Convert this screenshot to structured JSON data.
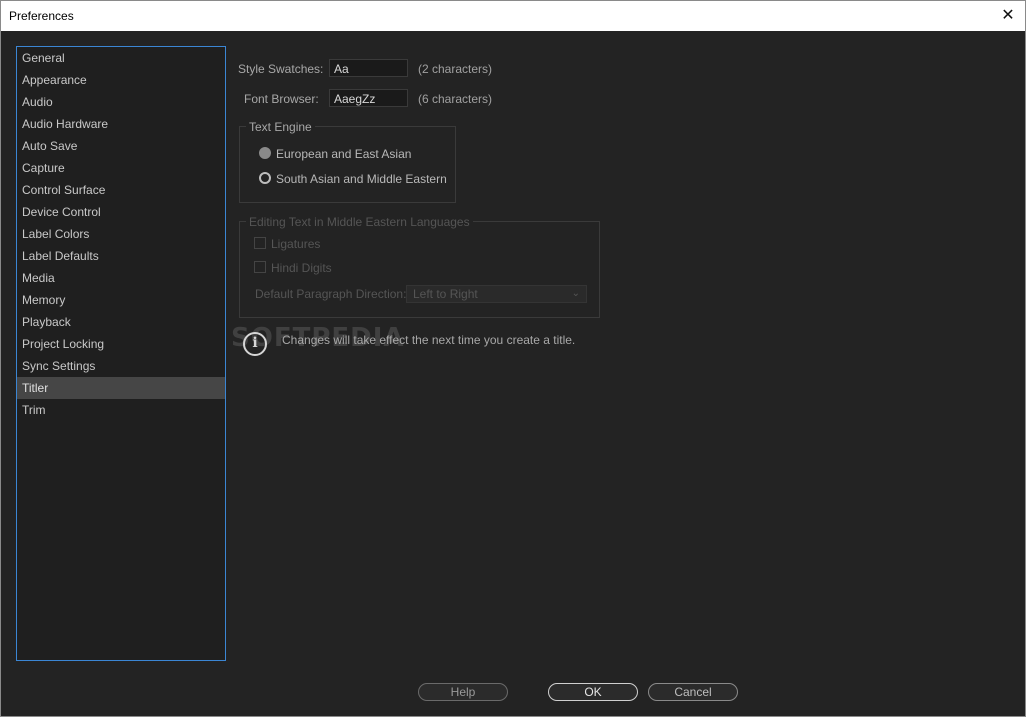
{
  "window": {
    "title": "Preferences",
    "close_symbol": "✕"
  },
  "sidebar": {
    "items": [
      {
        "label": "General"
      },
      {
        "label": "Appearance"
      },
      {
        "label": "Audio"
      },
      {
        "label": "Audio Hardware"
      },
      {
        "label": "Auto Save"
      },
      {
        "label": "Capture"
      },
      {
        "label": "Control Surface"
      },
      {
        "label": "Device Control"
      },
      {
        "label": "Label Colors"
      },
      {
        "label": "Label Defaults"
      },
      {
        "label": "Media"
      },
      {
        "label": "Memory"
      },
      {
        "label": "Playback"
      },
      {
        "label": "Project Locking"
      },
      {
        "label": "Sync Settings"
      },
      {
        "label": "Titler",
        "selected": true
      },
      {
        "label": "Trim"
      }
    ]
  },
  "titler": {
    "style_swatches": {
      "label": "Style Swatches:",
      "value": "Aa",
      "hint": "(2 characters)"
    },
    "font_browser": {
      "label": "Font Browser:",
      "value": "AaegZz",
      "hint": "(6 characters)"
    },
    "text_engine": {
      "title": "Text Engine",
      "options": [
        {
          "label": "European and East Asian",
          "checked": true
        },
        {
          "label": "South Asian and Middle Eastern",
          "checked": false
        }
      ]
    },
    "middle_eastern": {
      "title": "Editing Text in Middle Eastern Languages",
      "ligatures": "Ligatures",
      "hindi_digits": "Hindi Digits",
      "paragraph_direction_label": "Default Paragraph Direction:",
      "paragraph_direction_value": "Left to Right"
    },
    "info_message": "Changes will take effect the next time you create a title.",
    "watermark": "SOFTPEDIA"
  },
  "buttons": {
    "help": "Help",
    "ok": "OK",
    "cancel": "Cancel"
  },
  "colors": {
    "accent": "#3b86d4",
    "background": "#232323",
    "selected_item": "#464646"
  }
}
